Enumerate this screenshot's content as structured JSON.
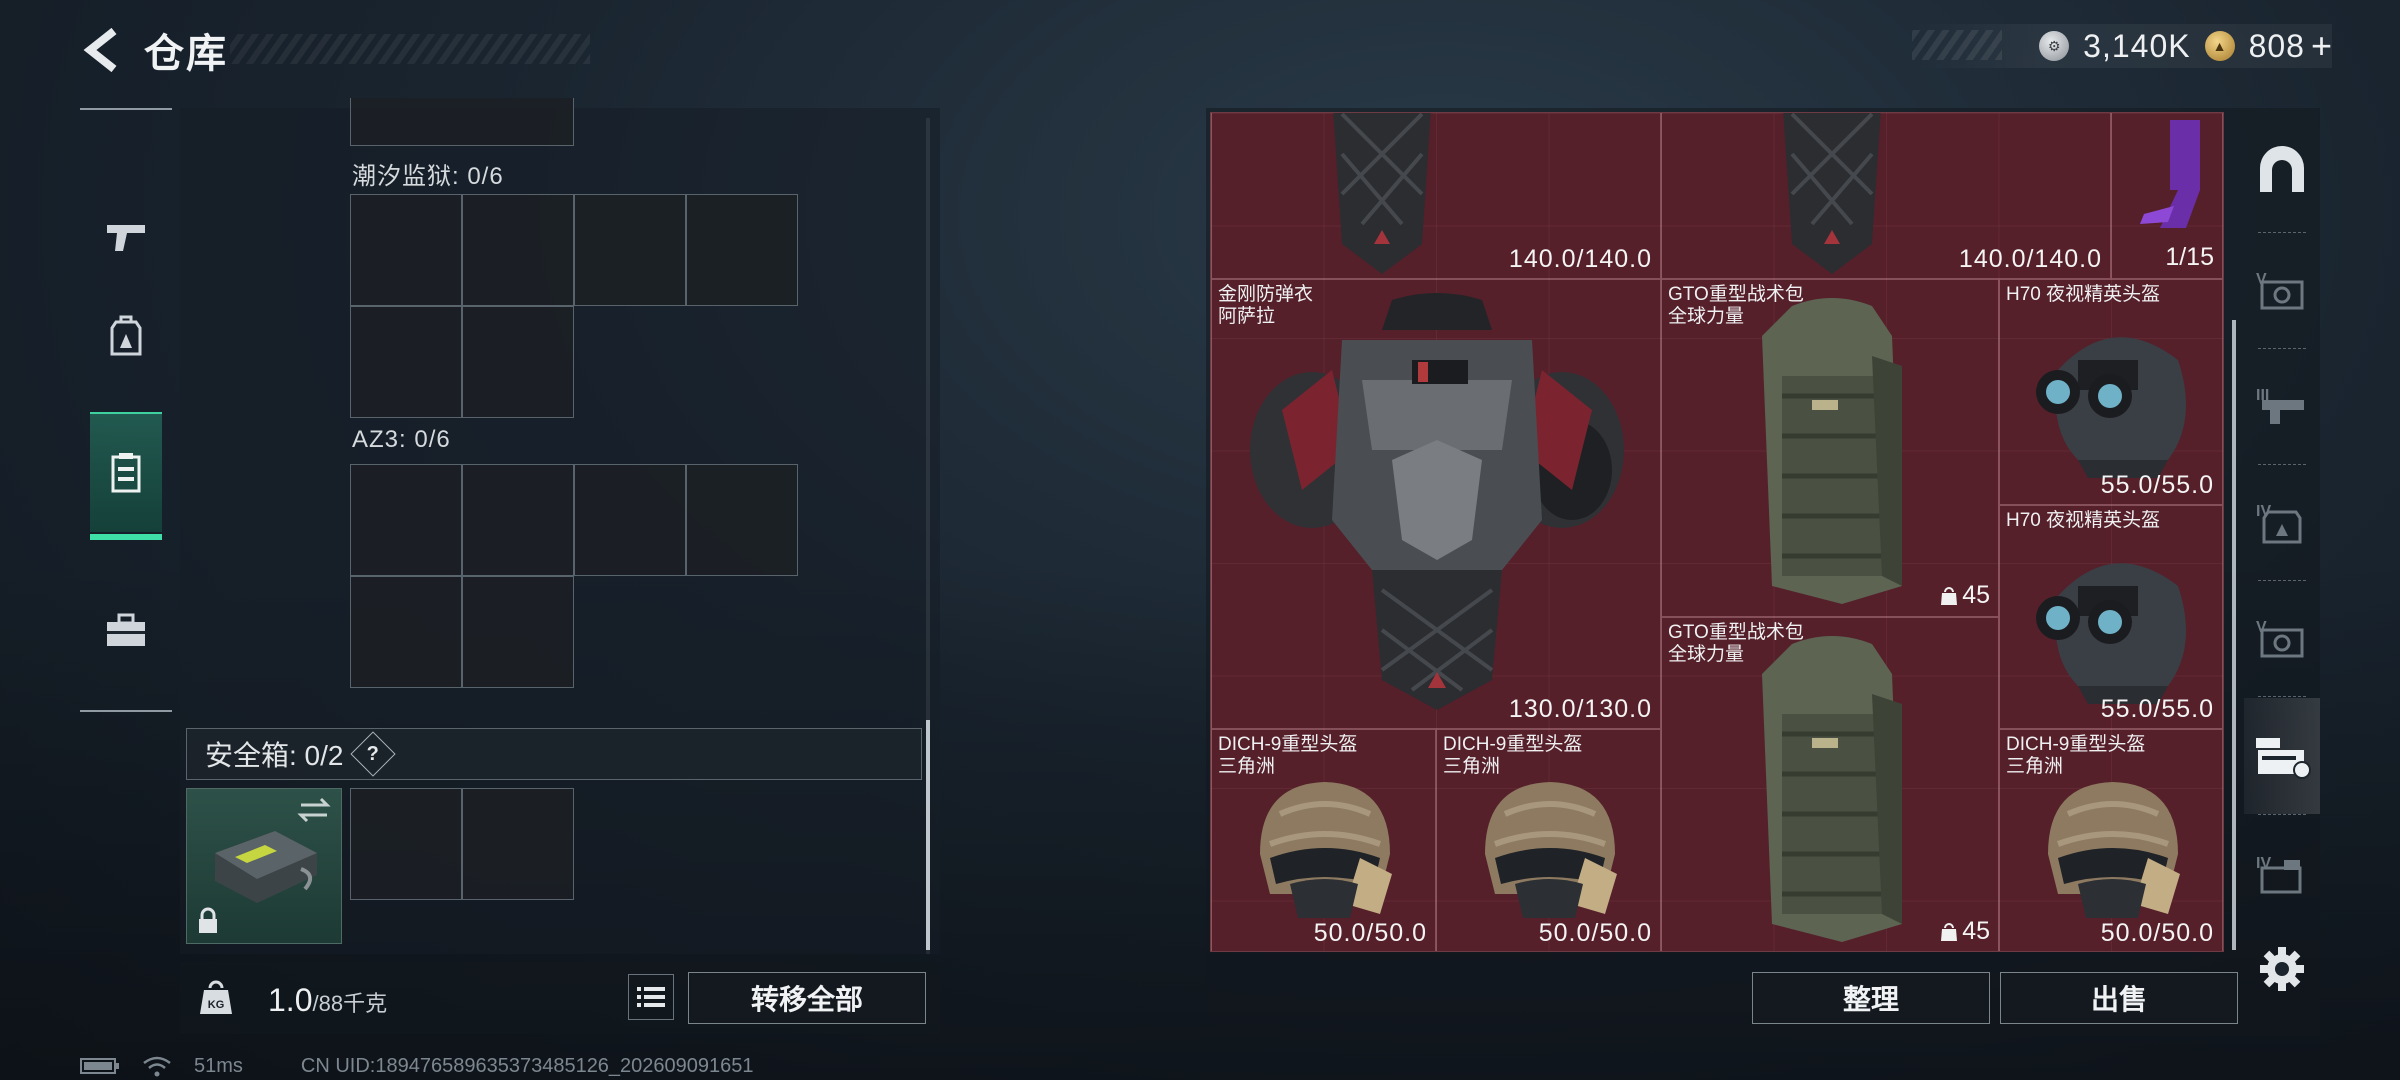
{
  "header": {
    "title": "仓库",
    "silver": "3,140K",
    "gold": "808",
    "plus": "+"
  },
  "left": {
    "slot1_label": "潮汐监狱: 0/6",
    "slot2_label": "AZ3: 0/6",
    "safebox_label": "安全箱: 0/2",
    "help": "?",
    "weight_value": "1.0",
    "weight_max": "/88千克",
    "weight_unit_icon": "KG",
    "transfer_all": "转移全部"
  },
  "storage": {
    "items": [
      {
        "name": "",
        "durability": "140.0/140.0"
      },
      {
        "name": "",
        "durability": "140.0/140.0"
      },
      {
        "name": "",
        "count": "1/15"
      },
      {
        "name": "金刚防弹衣\n阿萨拉",
        "durability": "130.0/130.0"
      },
      {
        "name": "GTO重型战术包\n全球力量",
        "capacity": "45"
      },
      {
        "name": "H70 夜视精英头盔",
        "durability": "55.0/55.0"
      },
      {
        "name": "H70 夜视精英头盔",
        "durability": "55.0/55.0"
      },
      {
        "name": "GTO重型战术包\n全球力量",
        "capacity": "45"
      },
      {
        "name": "DICH-9重型头盔\n三角洲",
        "durability": "50.0/50.0"
      },
      {
        "name": "DICH-9重型头盔\n三角洲",
        "durability": "50.0/50.0"
      },
      {
        "name": "DICH-9重型头盔\n三角洲",
        "durability": "50.0/50.0"
      }
    ],
    "sort_label": "整理",
    "sell_label": "出售"
  },
  "right_nav": [
    "V",
    "III",
    "IV",
    "V",
    "IV"
  ],
  "status": {
    "ping": "51ms",
    "uid": "CN UID:1894765896353734851​26_202609091651"
  },
  "colors": {
    "accent": "#3fe0a8",
    "storage_bg": "#4a1b24"
  }
}
